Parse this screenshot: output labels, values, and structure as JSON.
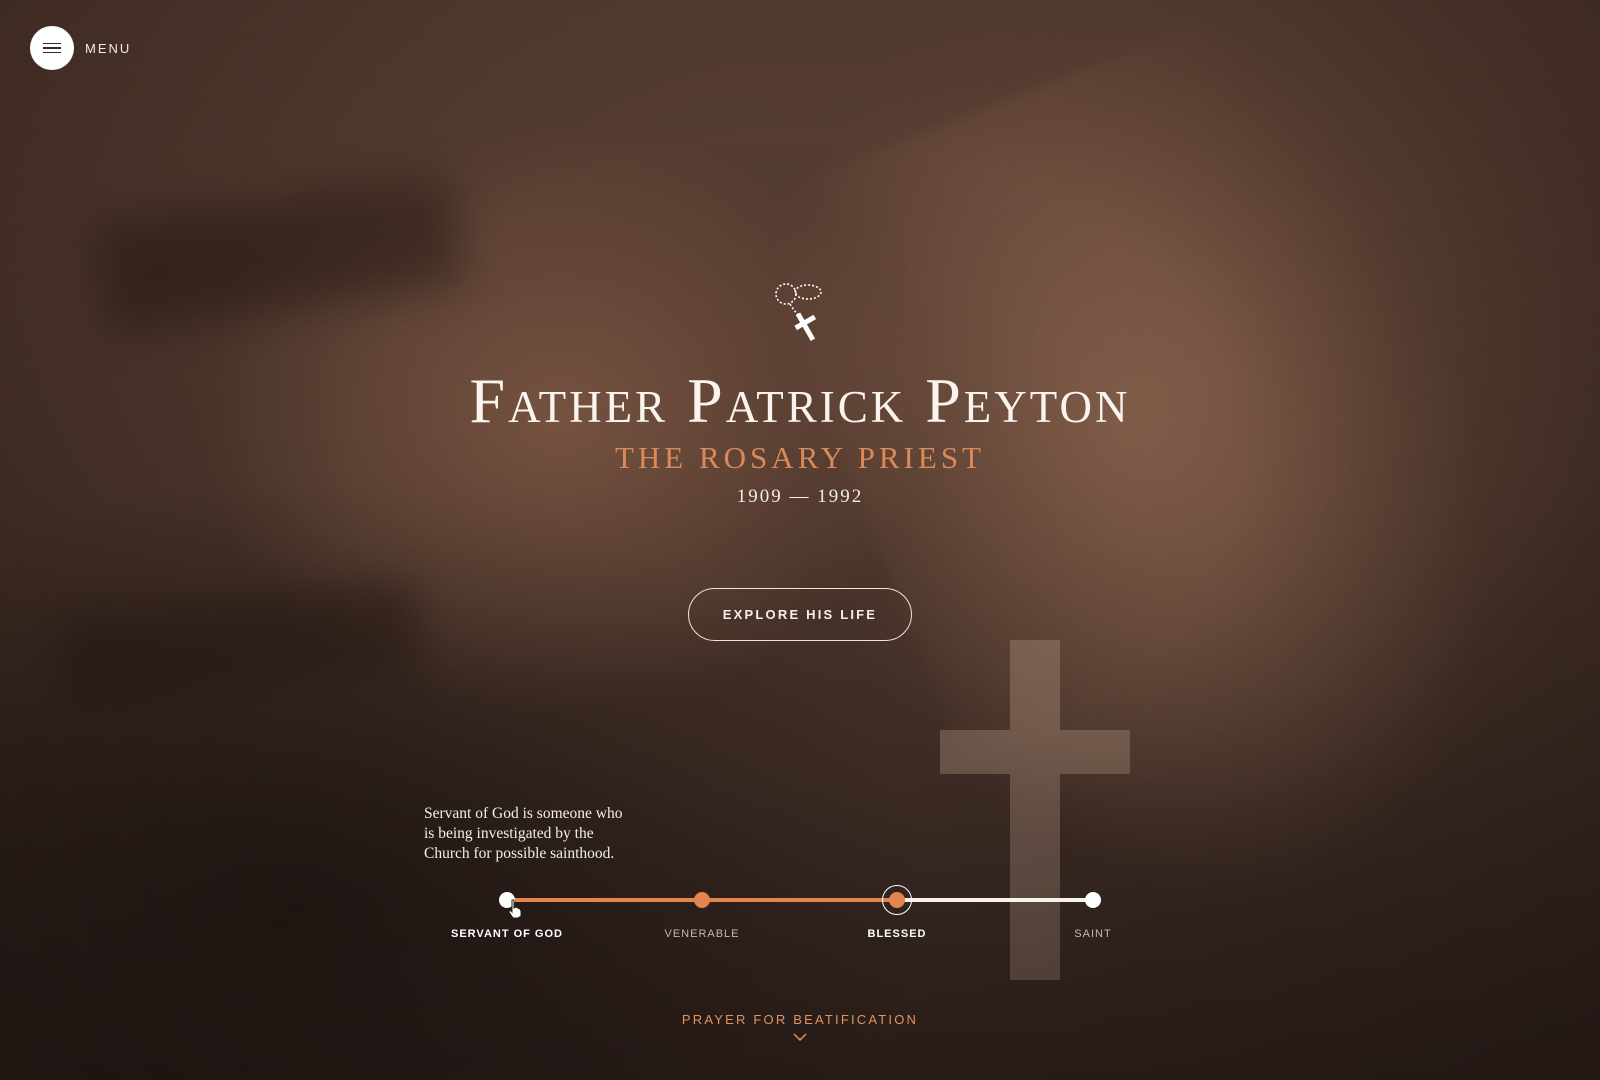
{
  "menu": {
    "label": "MENU",
    "icon": "hamburger-icon"
  },
  "hero": {
    "icon": "rosary-icon",
    "title": "Father Patrick Peyton",
    "subtitle": "THE ROSARY PRIEST",
    "dates": "1909 — 1992",
    "cta_label": "EXPLORE HIS LIFE"
  },
  "timeline": {
    "tooltip": "Servant of God is someone who is being investigated by the Church for possible sainthood.",
    "stages": [
      {
        "label": "SERVANT OF GOD"
      },
      {
        "label": "VENERABLE"
      },
      {
        "label": "BLESSED"
      },
      {
        "label": "SAINT"
      }
    ]
  },
  "footer": {
    "prayer_label": "PRAYER FOR BEATIFICATION",
    "icon": "chevron-down-icon"
  },
  "colors": {
    "accent": "#e5854e",
    "text": "#fbf4ee",
    "background": "#4b352b"
  }
}
